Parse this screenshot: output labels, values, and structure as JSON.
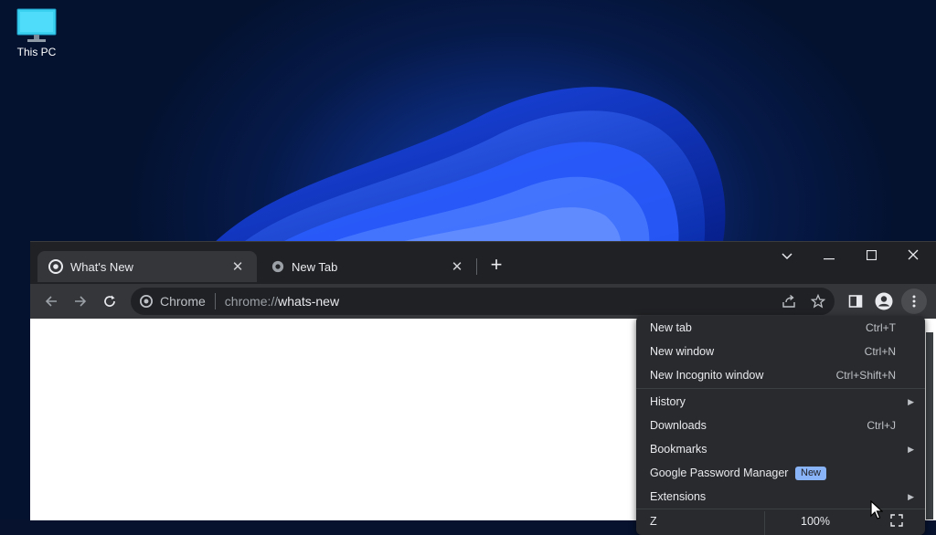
{
  "desktop": {
    "icon_label": "This PC"
  },
  "tabs": [
    {
      "label": "What's New",
      "active": true
    },
    {
      "label": "New Tab",
      "active": false
    }
  ],
  "omnibox": {
    "site_label": "Chrome",
    "scheme": "chrome://",
    "host": "whats-new"
  },
  "menu": {
    "items": [
      {
        "label": "New tab",
        "shortcut": "Ctrl+T"
      },
      {
        "label": "New window",
        "shortcut": "Ctrl+N"
      },
      {
        "label": "New Incognito window",
        "shortcut": "Ctrl+Shift+N"
      },
      {
        "label": "History",
        "shortcut": ""
      },
      {
        "label": "Downloads",
        "shortcut": "Ctrl+J"
      },
      {
        "label": "Bookmarks",
        "shortcut": ""
      },
      {
        "label": "Google Password Manager",
        "shortcut": ""
      },
      {
        "label": "Extensions",
        "shortcut": ""
      }
    ],
    "badge": "New",
    "zoom_label": "Z",
    "zoom_value": "100%"
  },
  "colors": {
    "accent": "#8ab4f8",
    "toolbar": "#35363a",
    "frame": "#202124",
    "menu": "#292a2d"
  }
}
